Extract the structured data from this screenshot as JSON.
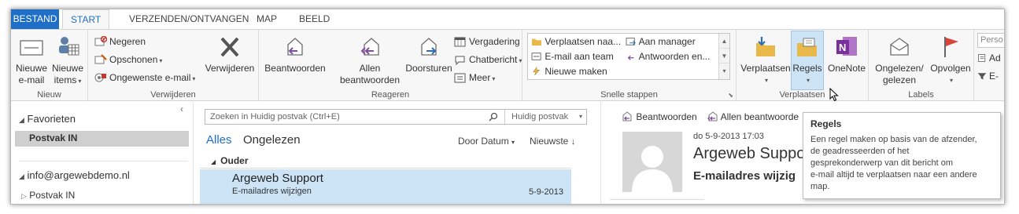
{
  "tabs": [
    "BESTAND",
    "START",
    "VERZENDEN/ONTVANGEN",
    "MAP",
    "BEELD"
  ],
  "groups": {
    "nieuw": {
      "label": "Nieuw",
      "new_email": "Nieuwe e-mail",
      "new_email_l1": "Nieuwe",
      "new_email_l2": "e-mail",
      "new_items_l1": "Nieuwe",
      "new_items_l2": "items"
    },
    "verwijderen": {
      "label": "Verwijderen",
      "ignore": "Negeren",
      "cleanup": "Opschonen",
      "junk": "Ongewenste e-mail",
      "delete": "Verwijderen"
    },
    "reageren": {
      "label": "Reageren",
      "reply": "Beantwoorden",
      "reply_all_l1": "Allen",
      "reply_all_l2": "beantwoorden",
      "forward": "Doorsturen",
      "meeting": "Vergadering",
      "chat": "Chatbericht",
      "more": "Meer"
    },
    "snelle": {
      "label": "Snelle stappen",
      "items": [
        "Verplaatsen naa...",
        "E-mail aan team",
        "Nieuwe maken",
        "Aan manager",
        "Antwoorden en..."
      ]
    },
    "verplaatsen": {
      "label": "Verplaatsen",
      "move": "Verplaatsen",
      "rules": "Regels",
      "onenote": "OneNote"
    },
    "labels": {
      "label": "Labels",
      "read_l1": "Ongelezen/",
      "read_l2": "gelezen",
      "followup": "Opvolgen"
    },
    "zoeken": {
      "people": "Perso",
      "ad": "Ad",
      "filter": "E-"
    }
  },
  "folders": {
    "favorites": "Favorieten",
    "inbox": "Postvak IN",
    "account": "info@argewebdemo.nl",
    "inbox2": "Postvak IN"
  },
  "message_list": {
    "search_placeholder": "Zoeken in Huidig postvak (Ctrl+E)",
    "search_scope": "Huidig postvak",
    "filter_all": "Alles",
    "filter_unread": "Ongelezen",
    "sort_by": "Door Datum",
    "sort_order": "Nieuwste",
    "group_header": "Ouder",
    "messages": [
      {
        "sender": "Argeweb Support",
        "subject": "E-mailadres wijzigen",
        "date": "5-9-2013"
      }
    ]
  },
  "reading_pane": {
    "reply": "Beantwoorden",
    "reply_all": "Allen beantwoorde",
    "date": "do 5-9-2013 17:03",
    "sender": "Argeweb Suppo",
    "subject": "E-mailadres wijzig"
  },
  "tooltip": {
    "title": "Regels",
    "lines": [
      "Een regel maken op basis van de afzender,",
      "de geadresseerden of het",
      "gesprekonderwerp van dit bericht om",
      "e-mail altijd te verplaatsen naar een andere",
      "map."
    ]
  },
  "colors": {
    "accent": "#1e6fc5",
    "selection": "#cde4f7",
    "ribbon_bg": "#f7f7f7"
  }
}
